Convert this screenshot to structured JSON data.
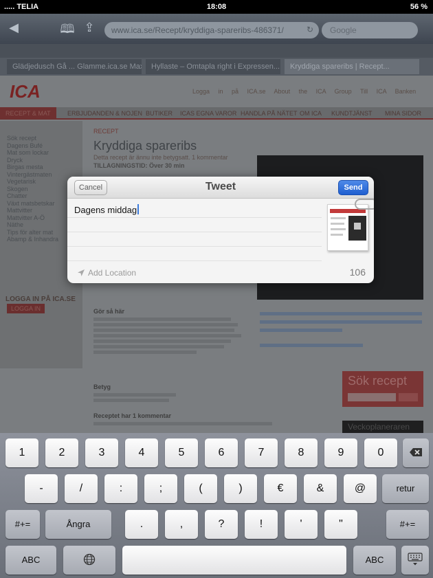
{
  "status": {
    "carrier": "..... TELIA",
    "time": "18:08",
    "battery": "56 %"
  },
  "safari": {
    "url": "www.ica.se/Recept/kryddiga-spareribs-486371/",
    "search_placeholder": "Google",
    "tabs": [
      "Glädjedusch Gå ... Glamme.ica.se Max ...",
      "Hyllaste – Omtapla right i Expressen...",
      "Kryddiga spareribs | Recept..."
    ]
  },
  "page": {
    "logo": "ICA",
    "top_links": "Logga in på ICA.se  About the ICA Group  Till ICA Banken",
    "nav": [
      "RECEPT & MAT",
      "ERBJUDANDEN & NOJEN",
      "BUTIKER",
      "ICAS EGNA VAROR",
      "HANDLA PÅ NÄTET",
      "OM ICA",
      "KUNDTJÄNST",
      "MINA SIDOR"
    ],
    "recipe_label": "RECEPT",
    "recipe_title": "Kryddiga spareribs",
    "rating_line": "Detta recept är ännu inte betygsatt.  1 kommentar",
    "time_line": "TILLAGNINGSTID: Över 30 min",
    "sidebar": [
      "Sök recept",
      "Dagens Bufé",
      "Mat som lockar",
      "Dryck",
      "Birgas mesta",
      "Vintergästmaten",
      "Vegetarisk",
      "Skogen",
      "Chatter",
      "Växt matsbetskar",
      "Mattvitter",
      "Mattvitter A-Ö",
      "Näthe",
      "Tips för alter mat",
      "Abamp & Inhandra"
    ],
    "login_title": "LOGGA IN PÅ ICA.SE",
    "login_button": "LOGGA IN",
    "steps_title": "Gör så här",
    "betyg": "Betyg",
    "comment_title": "Receptet har 1 kommentar",
    "search_title": "Sök recept",
    "veckoplaneraren": "Veckoplaneraren"
  },
  "tweet": {
    "cancel": "Cancel",
    "title": "Tweet",
    "send": "Send",
    "text": "Dagens middag",
    "add_location": "Add Location",
    "char_count": "106"
  },
  "keyboard": {
    "row1": [
      "1",
      "2",
      "3",
      "4",
      "5",
      "6",
      "7",
      "8",
      "9",
      "0"
    ],
    "row2": [
      "-",
      "/",
      ":",
      ";",
      "(",
      ")",
      "€",
      "&",
      "@"
    ],
    "return": "retur",
    "row3_left": "#+=",
    "undo": "Ångra",
    "row3": [
      ".",
      ",",
      "?",
      "!",
      "'",
      "\""
    ],
    "row3_right": "#+=",
    "abc_left": "ABC",
    "abc_right": "ABC"
  }
}
